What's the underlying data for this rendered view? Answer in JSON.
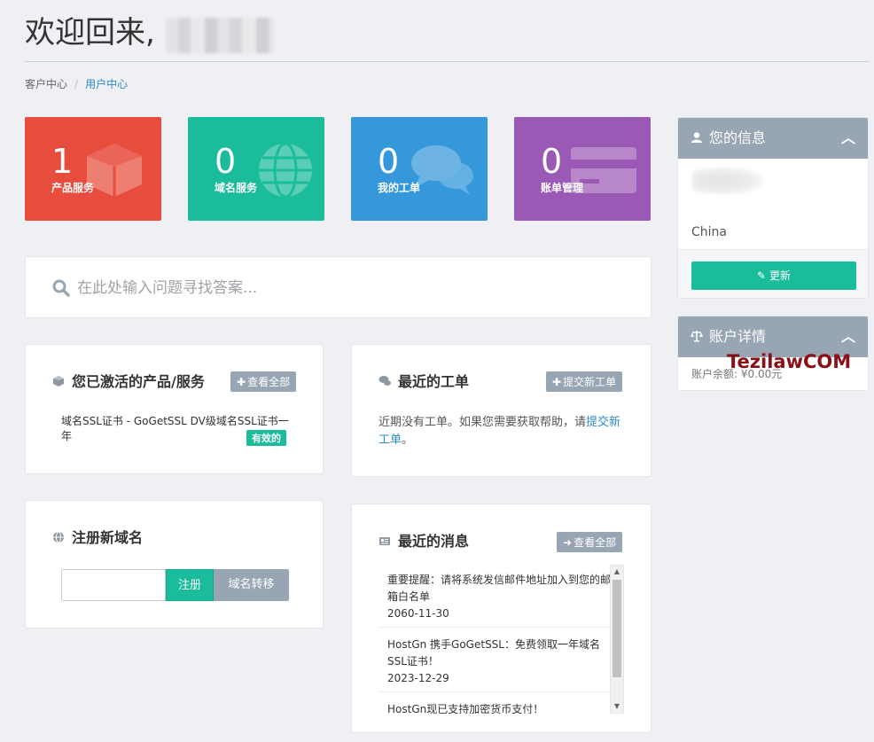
{
  "header": {
    "title": "欢迎回来,"
  },
  "breadcrumb": {
    "items": [
      "客户中心",
      "用户中心"
    ],
    "separator": "/"
  },
  "tiles": [
    {
      "count": "1",
      "label": "产品服务",
      "icon": "cube-icon",
      "color": "#e74c3c"
    },
    {
      "count": "0",
      "label": "域名服务",
      "icon": "globe-icon",
      "color": "#1abc9c"
    },
    {
      "count": "0",
      "label": "我的工单",
      "icon": "comments-icon",
      "color": "#3498db"
    },
    {
      "count": "0",
      "label": "账单管理",
      "icon": "credit-card-icon",
      "color": "#9b59b6"
    }
  ],
  "search": {
    "placeholder": "在此处输入问题寻找答案..."
  },
  "products_panel": {
    "title": "您已激活的产品/服务",
    "view_all": "查看全部",
    "product": "域名SSL证书 - GoGetSSL DV级域名SSL证书一年",
    "status": "有效的"
  },
  "tickets_panel": {
    "title": "最近的工单",
    "new_ticket": "提交新工单",
    "text": "近期没有工单。如果您需要获取帮助，请",
    "link": "提交新工单",
    "end": "。"
  },
  "domain_panel": {
    "title": "注册新域名",
    "register": "注册",
    "transfer": "域名转移"
  },
  "news_panel": {
    "title": "最近的消息",
    "view_all": "查看全部",
    "items": [
      {
        "title": "重要提醒：请将系统发信邮件地址加入到您的邮箱白名单",
        "date": "2060-11-30"
      },
      {
        "title": "HostGn 携手GoGetSSL：免费领取一年域名SSL证书！",
        "date": "2023-12-29"
      },
      {
        "title": "HostGn现已支持加密货币支付！",
        "date": ""
      }
    ]
  },
  "info_panel": {
    "title": "您的信息",
    "country": "China",
    "update": "更新"
  },
  "account_panel": {
    "title": "账户详情",
    "balance": "账户余额: ¥0.00元"
  },
  "watermark": "TezilawCOM",
  "colors": {
    "accent_green": "#1abc9c",
    "panel_header": "#98a6b3",
    "link": "#2e8bcc"
  }
}
